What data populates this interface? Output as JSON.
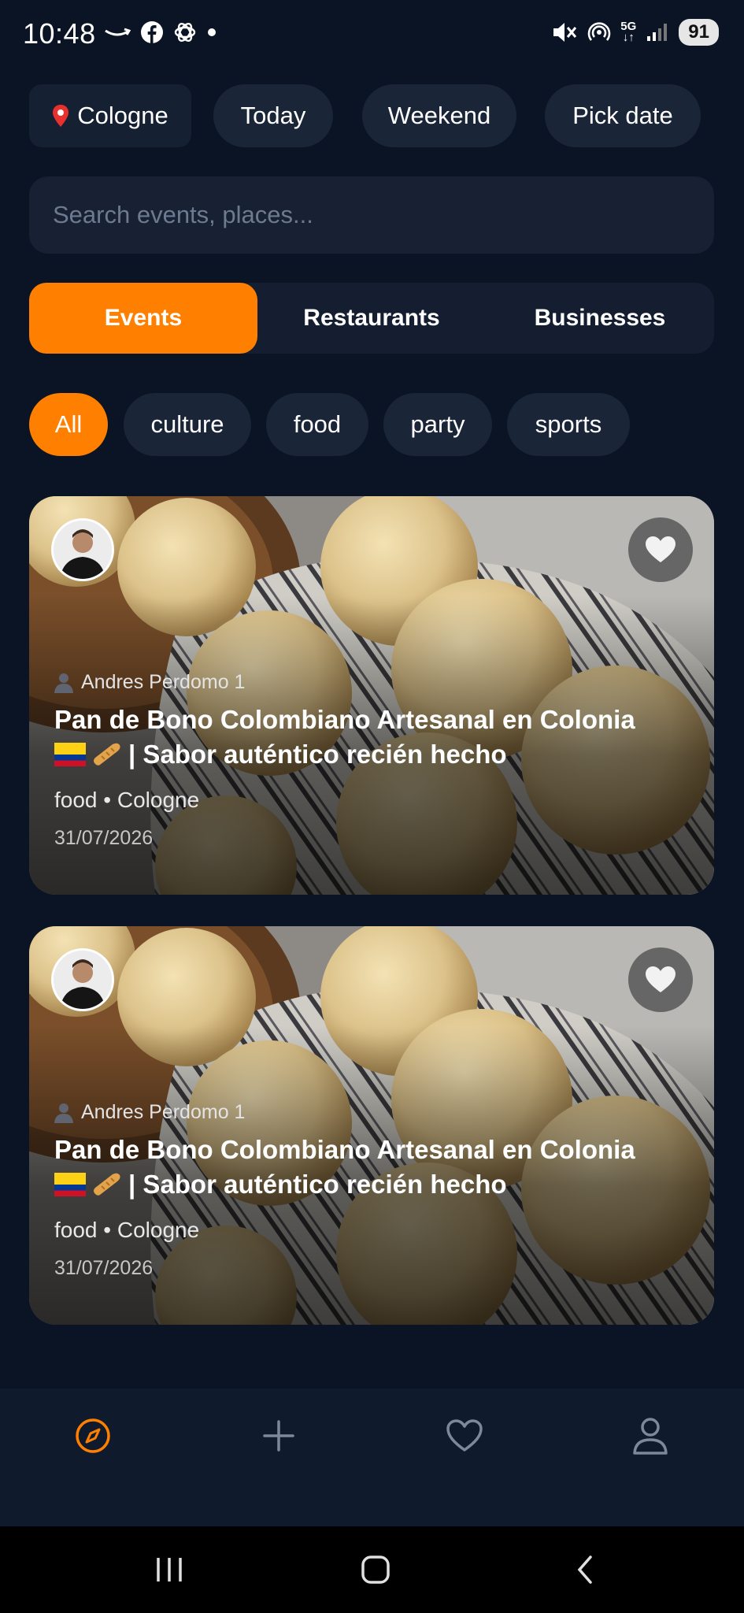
{
  "status_bar": {
    "time": "10:48",
    "battery": "91",
    "network": "5G"
  },
  "location_chip": {
    "label": "Cologne"
  },
  "date_filters": [
    {
      "label": "Today"
    },
    {
      "label": "Weekend"
    },
    {
      "label": "Pick date"
    }
  ],
  "search": {
    "placeholder": "Search events, places..."
  },
  "tabs": [
    {
      "label": "Events",
      "active": true
    },
    {
      "label": "Restaurants",
      "active": false
    },
    {
      "label": "Businesses",
      "active": false
    }
  ],
  "categories": [
    {
      "label": "All",
      "active": true
    },
    {
      "label": "culture",
      "active": false
    },
    {
      "label": "food",
      "active": false
    },
    {
      "label": "party",
      "active": false
    },
    {
      "label": "sports",
      "active": false
    }
  ],
  "cards": [
    {
      "author": "Andres Perdomo 1",
      "title_line1": "Pan de Bono Colombiano Artesanal en Colonia",
      "title_line2": "| Sabor auténtico recién hecho",
      "meta": "food • Cologne",
      "date": "31/07/2026"
    },
    {
      "author": "Andres Perdomo 1",
      "title_line1": "Pan de Bono Colombiano Artesanal en Colonia",
      "title_line2": "| Sabor auténtico recién hecho",
      "meta": "food • Cologne",
      "date": "31/07/2026"
    }
  ],
  "bottom_nav": [
    {
      "icon": "compass-icon",
      "active": true
    },
    {
      "icon": "plus-icon",
      "active": false
    },
    {
      "icon": "heart-icon",
      "active": false
    },
    {
      "icon": "profile-icon",
      "active": false
    }
  ],
  "colors": {
    "accent": "#ff7f00",
    "background": "#0b1424",
    "chip": "#1b2538"
  }
}
